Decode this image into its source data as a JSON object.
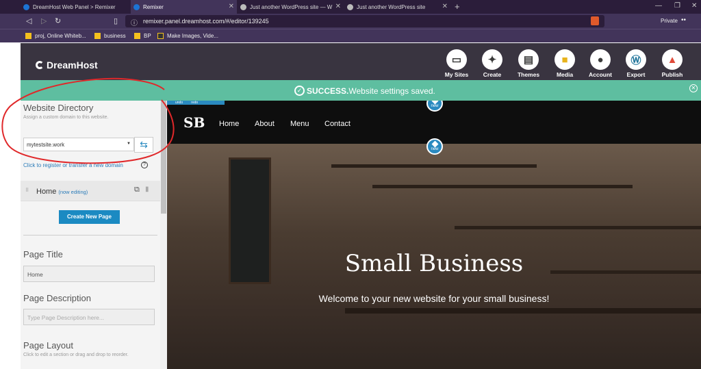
{
  "browser": {
    "tabs": [
      {
        "title": "DreamHost Web Panel > Remixer",
        "color": "#1c74d4"
      },
      {
        "title": "Remixer",
        "color": "#1c74d4"
      },
      {
        "title": "Just another WordPress site — W",
        "color": "#bbb"
      },
      {
        "title": "Just another WordPress site",
        "color": "#bbb"
      }
    ],
    "url": "remixer.panel.dreamhost.com/#/editor/139245",
    "private_label": "Private",
    "bookmarks": [
      {
        "label": "proj, Online Whiteb...",
        "color": "#f4c01e"
      },
      {
        "label": "business",
        "color": "#f4c01e"
      },
      {
        "label": "BP",
        "color": "#f4c01e"
      },
      {
        "label": "Make Images, Vide...",
        "color": "#333"
      }
    ]
  },
  "app": {
    "logo": "DreamHost",
    "toolbar": [
      {
        "label": "My Sites",
        "icon": "browser-window-icon"
      },
      {
        "label": "Create",
        "icon": "magic-wand-icon"
      },
      {
        "label": "Themes",
        "icon": "layout-icon"
      },
      {
        "label": "Media",
        "icon": "folder-icon"
      },
      {
        "label": "Account",
        "icon": "user-icon"
      },
      {
        "label": "Export",
        "icon": "wordpress-icon"
      },
      {
        "label": "Publish",
        "icon": "rocket-icon"
      }
    ],
    "success_prefix": "SUCCESS.",
    "success_text": " Website settings saved."
  },
  "sidebar": {
    "website_directory": "Website Directory",
    "directory_hint": "Assign a custom domain to this website.",
    "domain": "mytestsite.work",
    "register_link": "Click to register or transfer a new domain",
    "page_name": "Home",
    "page_status": "(now editing)",
    "create_page": "Create New Page",
    "page_title_label": "Page Title",
    "page_title_value": "Home",
    "page_desc_label": "Page Description",
    "page_desc_placeholder": "Type Page Description here...",
    "page_layout_label": "Page Layout",
    "page_layout_hint": "Click to edit a section or drag and drop to reorder."
  },
  "preview": {
    "undo": "undo",
    "redo": "redo",
    "new_badge": "new",
    "logo": "SB",
    "nav": [
      "Home",
      "About",
      "Menu",
      "Contact"
    ],
    "hero_title": "Small Business",
    "hero_subtitle": "Welcome to your new website for your small business!"
  },
  "colors": {
    "success_bg": "#5ebea0",
    "accent": "#1b8ac2",
    "annotation": "#e0282a"
  }
}
